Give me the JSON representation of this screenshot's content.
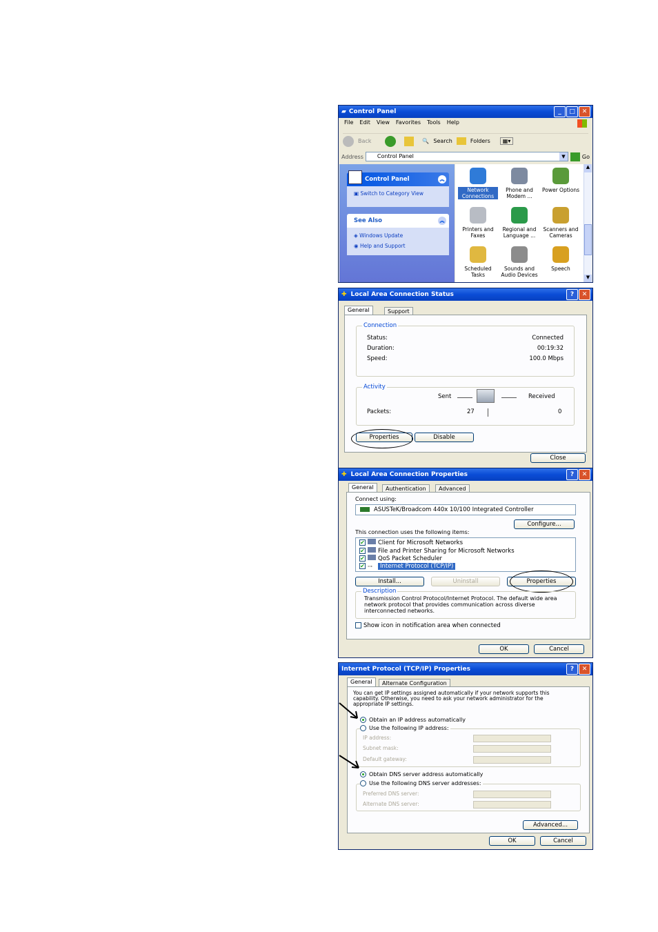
{
  "control_panel": {
    "title": "Control Panel",
    "menu": [
      "File",
      "Edit",
      "View",
      "Favorites",
      "Tools",
      "Help"
    ],
    "toolbar": {
      "back": "Back",
      "search": "Search",
      "folders": "Folders"
    },
    "address": {
      "label": "Address",
      "value": "Control Panel",
      "go": "Go"
    },
    "sidebar": {
      "panel_title": "Control Panel",
      "switch_link": "Switch to Category View",
      "see_also_title": "See Also",
      "links": [
        "Windows Update",
        "Help and Support"
      ]
    },
    "icons": [
      {
        "label": "Network Connections",
        "icon": "network-icon",
        "selected": true
      },
      {
        "label": "Phone and Modem ...",
        "icon": "phone-icon"
      },
      {
        "label": "Power Options",
        "icon": "power-icon"
      },
      {
        "label": "Printers and Faxes",
        "icon": "printer-icon"
      },
      {
        "label": "Regional and Language ...",
        "icon": "globe-icon"
      },
      {
        "label": "Scanners and Cameras",
        "icon": "scanner-icon"
      },
      {
        "label": "Scheduled Tasks",
        "icon": "tasks-icon"
      },
      {
        "label": "Sounds and Audio Devices",
        "icon": "speaker-icon"
      },
      {
        "label": "Speech",
        "icon": "speech-icon"
      }
    ]
  },
  "status": {
    "title": "Local Area Connection Status",
    "tabs": [
      "General",
      "Support"
    ],
    "connection_label": "Connection",
    "rows": [
      {
        "label": "Status:",
        "value": "Connected"
      },
      {
        "label": "Duration:",
        "value": "00:19:32"
      },
      {
        "label": "Speed:",
        "value": "100.0 Mbps"
      }
    ],
    "activity_label": "Activity",
    "sent": "Sent",
    "received": "Received",
    "packets_label": "Packets:",
    "packets_sent": "27",
    "packets_received": "0",
    "properties": "Properties",
    "disable": "Disable",
    "close": "Close"
  },
  "lan_props": {
    "title": "Local Area Connection Properties",
    "tabs": [
      "General",
      "Authentication",
      "Advanced"
    ],
    "connect_using": "Connect using:",
    "adapter": "ASUSTeK/Broadcom 440x 10/100 Integrated Controller",
    "configure": "Configure...",
    "items_label": "This connection uses the following items:",
    "items": [
      "Client for Microsoft Networks",
      "File and Printer Sharing for Microsoft Networks",
      "QoS Packet Scheduler",
      "Internet Protocol (TCP/IP)"
    ],
    "install": "Install...",
    "uninstall": "Uninstall",
    "properties": "Properties",
    "description_label": "Description",
    "description": "Transmission Control Protocol/Internet Protocol. The default wide area network protocol that provides communication across diverse interconnected networks.",
    "show_icon": "Show icon in notification area when connected",
    "ok": "OK",
    "cancel": "Cancel"
  },
  "tcpip": {
    "title": "Internet Protocol (TCP/IP) Properties",
    "tabs": [
      "General",
      "Alternate Configuration"
    ],
    "intro": "You can get IP settings assigned automatically if your network supports this capability. Otherwise, you need to ask your network administrator for the appropriate IP settings.",
    "obtain_ip": "Obtain an IP address automatically",
    "use_ip": "Use the following IP address:",
    "ip_fields": [
      "IP address:",
      "Subnet mask:",
      "Default gateway:"
    ],
    "obtain_dns": "Obtain DNS server address automatically",
    "use_dns": "Use the following DNS server addresses:",
    "dns_fields": [
      "Preferred DNS server:",
      "Alternate DNS server:"
    ],
    "advanced": "Advanced...",
    "ok": "OK",
    "cancel": "Cancel"
  }
}
